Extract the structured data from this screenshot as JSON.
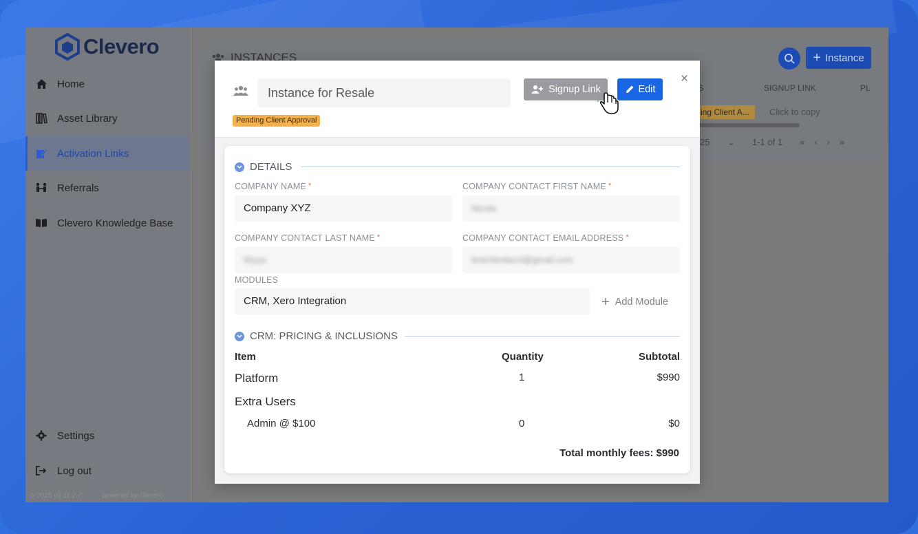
{
  "brand": {
    "name": "Clevero"
  },
  "sidebar": {
    "items": [
      {
        "label": "Home",
        "icon": "home-icon"
      },
      {
        "label": "Asset Library",
        "icon": "library-icon"
      },
      {
        "label": "Activation Links",
        "icon": "activation-link-icon",
        "active": true
      },
      {
        "label": "Referrals",
        "icon": "referrals-icon"
      },
      {
        "label": "Clevero Knowledge Base",
        "icon": "book-icon"
      }
    ],
    "settings_label": "Settings",
    "logout_label": "Log out",
    "version": "© 2025 v3.11.2.7",
    "powered_by": "powered by Clevero"
  },
  "background_page": {
    "title": "INSTANCES",
    "new_instance_label": "Instance",
    "columns": [
      "S",
      "SIGNUP LINK",
      "PL"
    ],
    "row": {
      "status_chip": "ing Client A...",
      "signup_link": "Click to copy"
    },
    "pager": {
      "page_size": "25",
      "range": "1-1 of 1"
    }
  },
  "modal": {
    "instance_name": "Instance for Resale",
    "status": "Pending Client Approval",
    "signup_link_label": "Signup Link",
    "edit_label": "Edit",
    "close_label": "×",
    "details_title": "DETAILS",
    "fields": {
      "company_name_label": "COMPANY NAME",
      "company_name_value": "Company XYZ",
      "first_name_label": "COMPANY CONTACT FIRST NAME",
      "first_name_value": "Nicola",
      "last_name_label": "COMPANY CONTACT LAST NAME",
      "last_name_value": "Wyya",
      "email_label": "COMPANY CONTACT EMAIL ADDRESS",
      "email_value": "testclientacct@gmail.com",
      "modules_label": "MODULES",
      "modules_value": "CRM, Xero Integration",
      "add_module_label": "Add Module"
    },
    "pricing_title": "CRM: PRICING & INCLUSIONS",
    "table": {
      "headers": {
        "item": "Item",
        "quantity": "Quantity",
        "subtotal": "Subtotal"
      },
      "rows": [
        {
          "item": "Platform",
          "quantity": "1",
          "subtotal": "$990"
        },
        {
          "item": "Extra Users",
          "quantity": "",
          "subtotal": ""
        },
        {
          "item": "Admin @ $100",
          "quantity": "0",
          "subtotal": "$0"
        }
      ],
      "total": "Total monthly fees: $990"
    }
  },
  "colors": {
    "accent": "#1967e5",
    "badge": "#f4b04a",
    "frame": "#2f6fe0"
  }
}
